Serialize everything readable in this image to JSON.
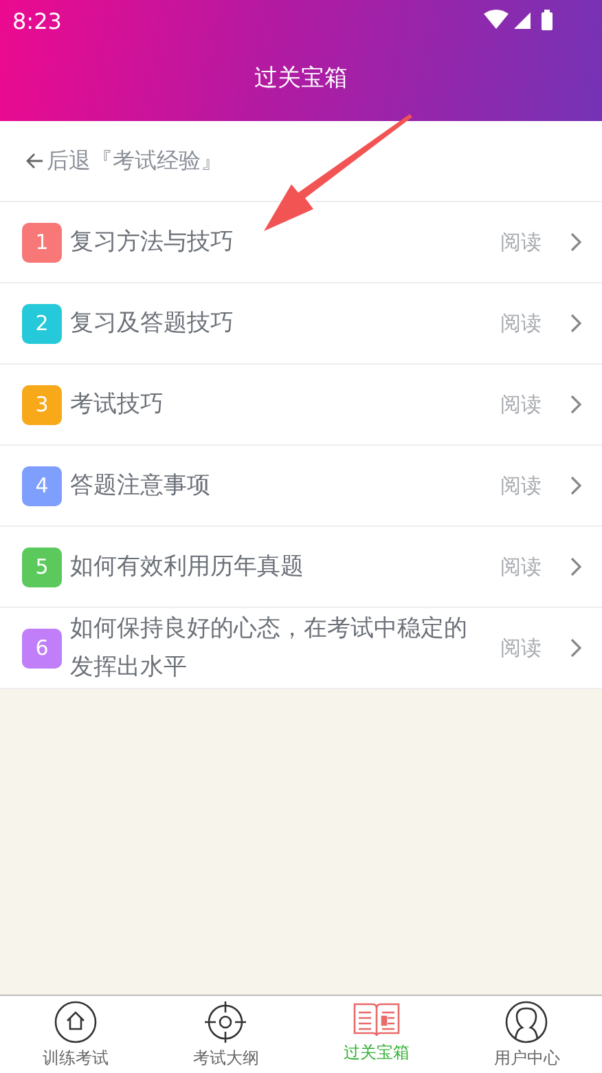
{
  "status_bar": {
    "time": "8:23"
  },
  "header": {
    "title": "过关宝箱"
  },
  "back_link": {
    "label": "后退『考试经验』"
  },
  "articles": [
    {
      "number": "1",
      "title": "复习方法与技巧",
      "action": "阅读",
      "color": "#f87878"
    },
    {
      "number": "2",
      "title": "复习及答题技巧",
      "action": "阅读",
      "color": "#26c9d9"
    },
    {
      "number": "3",
      "title": "考试技巧",
      "action": "阅读",
      "color": "#f8a91a"
    },
    {
      "number": "4",
      "title": "答题注意事项",
      "action": "阅读",
      "color": "#7f9ffe"
    },
    {
      "number": "5",
      "title": "如何有效利用历年真题",
      "action": "阅读",
      "color": "#5bc95b"
    },
    {
      "number": "6",
      "title": "如何保持良好的心态，在考试中稳定的发挥出水平",
      "action": "阅读",
      "color": "#c07ff8"
    }
  ],
  "tab_bar": [
    {
      "label": "训练考试",
      "selected": false
    },
    {
      "label": "考试大纲",
      "selected": false
    },
    {
      "label": "过关宝箱",
      "selected": true
    },
    {
      "label": "用户中心",
      "selected": false
    }
  ]
}
